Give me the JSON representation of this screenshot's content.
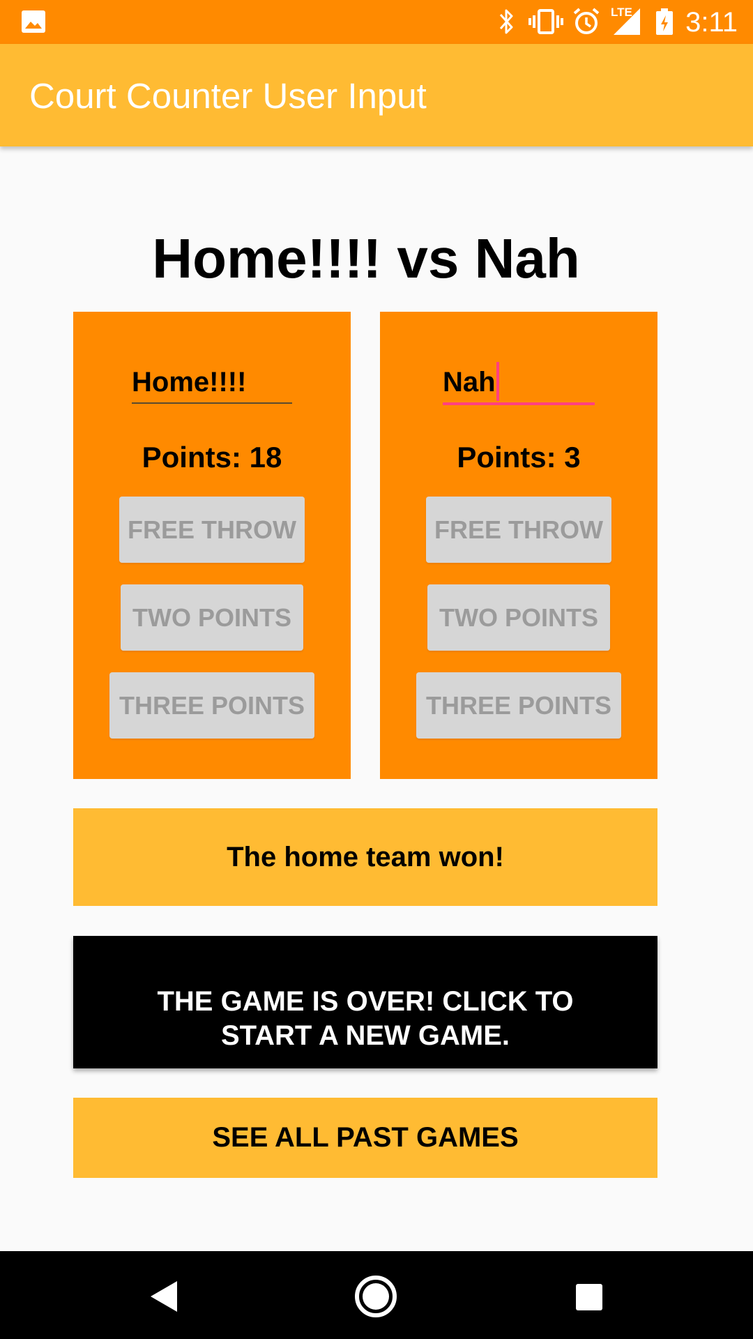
{
  "status_bar": {
    "time": "3:11",
    "network_label": "LTE",
    "icons": [
      "image-notification-icon",
      "bluetooth-icon",
      "vibrate-icon",
      "alarm-icon",
      "signal-icon",
      "battery-icon"
    ]
  },
  "app_bar": {
    "title": "Court Counter User Input"
  },
  "match": {
    "title": "Home!!!! vs Nah"
  },
  "home": {
    "name": "Home!!!!",
    "points_text": "Points: 18",
    "free_throw": "FREE THROW",
    "two_points": "TWO POINTS",
    "three_points": "THREE POINTS"
  },
  "away": {
    "name": "Nah",
    "points_text": "Points: 3",
    "free_throw": "FREE THROW",
    "two_points": "TWO POINTS",
    "three_points": "THREE POINTS"
  },
  "result": {
    "text": "The home team won!"
  },
  "actions": {
    "new_game_label": "THE GAME IS OVER! CLICK TO START A NEW GAME.",
    "past_games_label": "SEE ALL PAST GAMES"
  },
  "nav_bar": {
    "icons": [
      "back-icon",
      "home-icon",
      "recents-icon"
    ]
  },
  "colors": {
    "status_bar": "#ff8a00",
    "app_bar": "#ffbb33",
    "panel": "#ff8a00",
    "banner": "#ffbb33",
    "disabled_button": "#d6d6d6",
    "accent": "#ff4081"
  }
}
